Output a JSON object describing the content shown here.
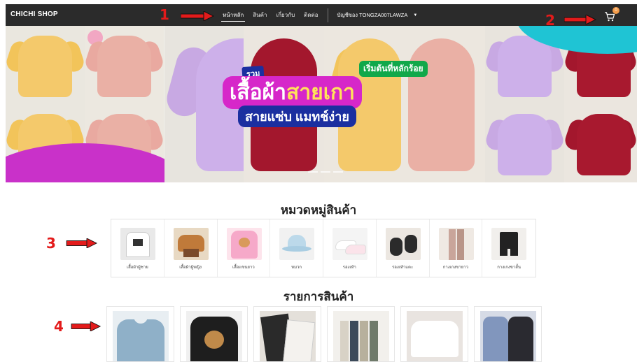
{
  "navbar": {
    "brand": "CHICHI SHOP",
    "links": [
      "หน้าหลัก",
      "สินค้า",
      "เกี่ยวกับ",
      "ติดต่อ"
    ],
    "active_index": 0,
    "account_label": "บัญชีของ TONGZA007LAWZA",
    "cart_count": "0"
  },
  "banner": {
    "tag": "รวม",
    "headline_part1": "เสื้อผ้า",
    "headline_part2": "สายเกา",
    "subline": "สายแซ่บ แมทช์ง่าย",
    "price_tag": "เริ่มต้นที่หลักร้อย"
  },
  "categories_title": "หมวดหมู่สินค้า",
  "categories": [
    {
      "label": "เสื้อผ้าผู้ชาย"
    },
    {
      "label": "เสื้อผ้าผู้หญิง"
    },
    {
      "label": "เสื้อแขนยาว"
    },
    {
      "label": "หมวก"
    },
    {
      "label": "รองเท้า"
    },
    {
      "label": "รองเท้าแตะ"
    },
    {
      "label": "กางเกงขายาว"
    },
    {
      "label": "กางเกงขาสั้น"
    }
  ],
  "products_title": "รายการสินค้า",
  "annotations": [
    "1",
    "2",
    "3",
    "4"
  ],
  "colors": {
    "navbar": "#2b2b2b",
    "annotation_red": "#e31b1b",
    "badge": "#f39c4a",
    "promo_magenta": "#d627c9",
    "promo_blue": "#1b2fa0",
    "promo_green": "#11a84a"
  }
}
